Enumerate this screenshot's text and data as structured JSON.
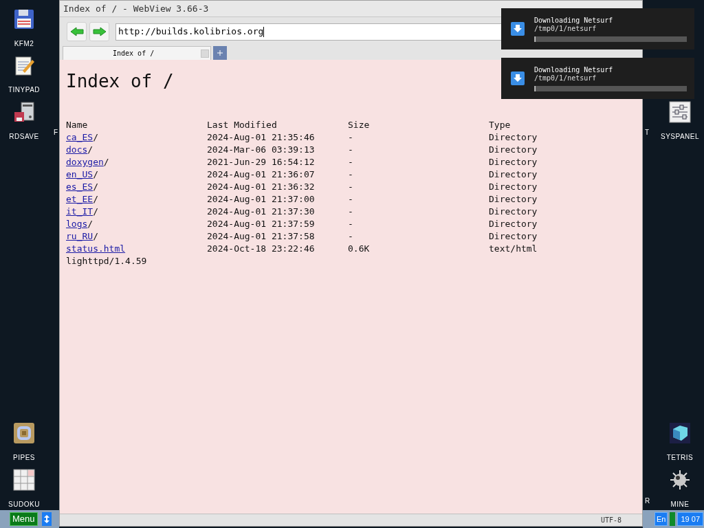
{
  "desktop": {
    "left_icons": [
      {
        "label": "KFM2",
        "kind": "floppy"
      },
      {
        "label": "TINYPAD",
        "kind": "notepad"
      },
      {
        "label": "RDSAVE",
        "kind": "disk"
      },
      {
        "label": "PIPES",
        "kind": "pipes"
      },
      {
        "label": "SUDOKU",
        "kind": "sudoku"
      }
    ],
    "right_icons": [
      {
        "label": "SYSPANEL",
        "kind": "sliders"
      },
      {
        "label": "TETRIS",
        "kind": "tetris"
      },
      {
        "label": "MINE",
        "kind": "mine"
      }
    ],
    "cut_labels": [
      "F",
      "T",
      "R"
    ]
  },
  "window": {
    "title": "Index of / - WebView 3.66-3",
    "url": "http://builds.kolibrios.org",
    "tabs": [
      {
        "label": "Index of /",
        "selected": true
      }
    ],
    "page": {
      "heading": "Index of /",
      "columns": [
        "Name",
        "Last Modified",
        "Size",
        "Type"
      ],
      "rows": [
        {
          "kind": "directory",
          "name": "ca_ES/",
          "modified": "2024-Aug-01 21:35:46",
          "size": "-",
          "type": "Directory"
        },
        {
          "kind": "directory",
          "name": "docs/",
          "modified": "2024-Mar-06 03:39:13",
          "size": "-",
          "type": "Directory"
        },
        {
          "kind": "directory",
          "name": "doxygen/",
          "modified": "2021-Jun-29 16:54:12",
          "size": "-",
          "type": "Directory"
        },
        {
          "kind": "directory",
          "name": "en_US/",
          "modified": "2024-Aug-01 21:36:07",
          "size": "-",
          "type": "Directory"
        },
        {
          "kind": "directory",
          "name": "es_ES/",
          "modified": "2024-Aug-01 21:36:32",
          "size": "-",
          "type": "Directory"
        },
        {
          "kind": "directory",
          "name": "et_EE/",
          "modified": "2024-Aug-01 21:37:00",
          "size": "-",
          "type": "Directory"
        },
        {
          "kind": "directory",
          "name": "it_IT/",
          "modified": "2024-Aug-01 21:37:30",
          "size": "-",
          "type": "Directory"
        },
        {
          "kind": "directory",
          "name": "logs/",
          "modified": "2024-Aug-01 21:37:59",
          "size": "-",
          "type": "Directory"
        },
        {
          "kind": "directory",
          "name": "ru_RU/",
          "modified": "2024-Aug-01 21:37:58",
          "size": "-",
          "type": "Directory"
        },
        {
          "kind": "file",
          "name": "status.html",
          "modified": "2024-Oct-18 23:22:46",
          "size": "0.6K",
          "type": "text/html"
        }
      ],
      "footer": "lighttpd/1.4.59"
    },
    "status_bar": {
      "encoding": "UTF-8"
    }
  },
  "notifications": [
    {
      "title": "Downloading Netsurf",
      "path": "/tmp0/1/netsurf",
      "level": 0.005
    },
    {
      "title": "Downloading Netsurf",
      "path": "/tmp0/1/netsurf",
      "level": 0.005
    }
  ],
  "taskbar": {
    "menu": "Menu",
    "language": "En",
    "time": "19 07"
  }
}
